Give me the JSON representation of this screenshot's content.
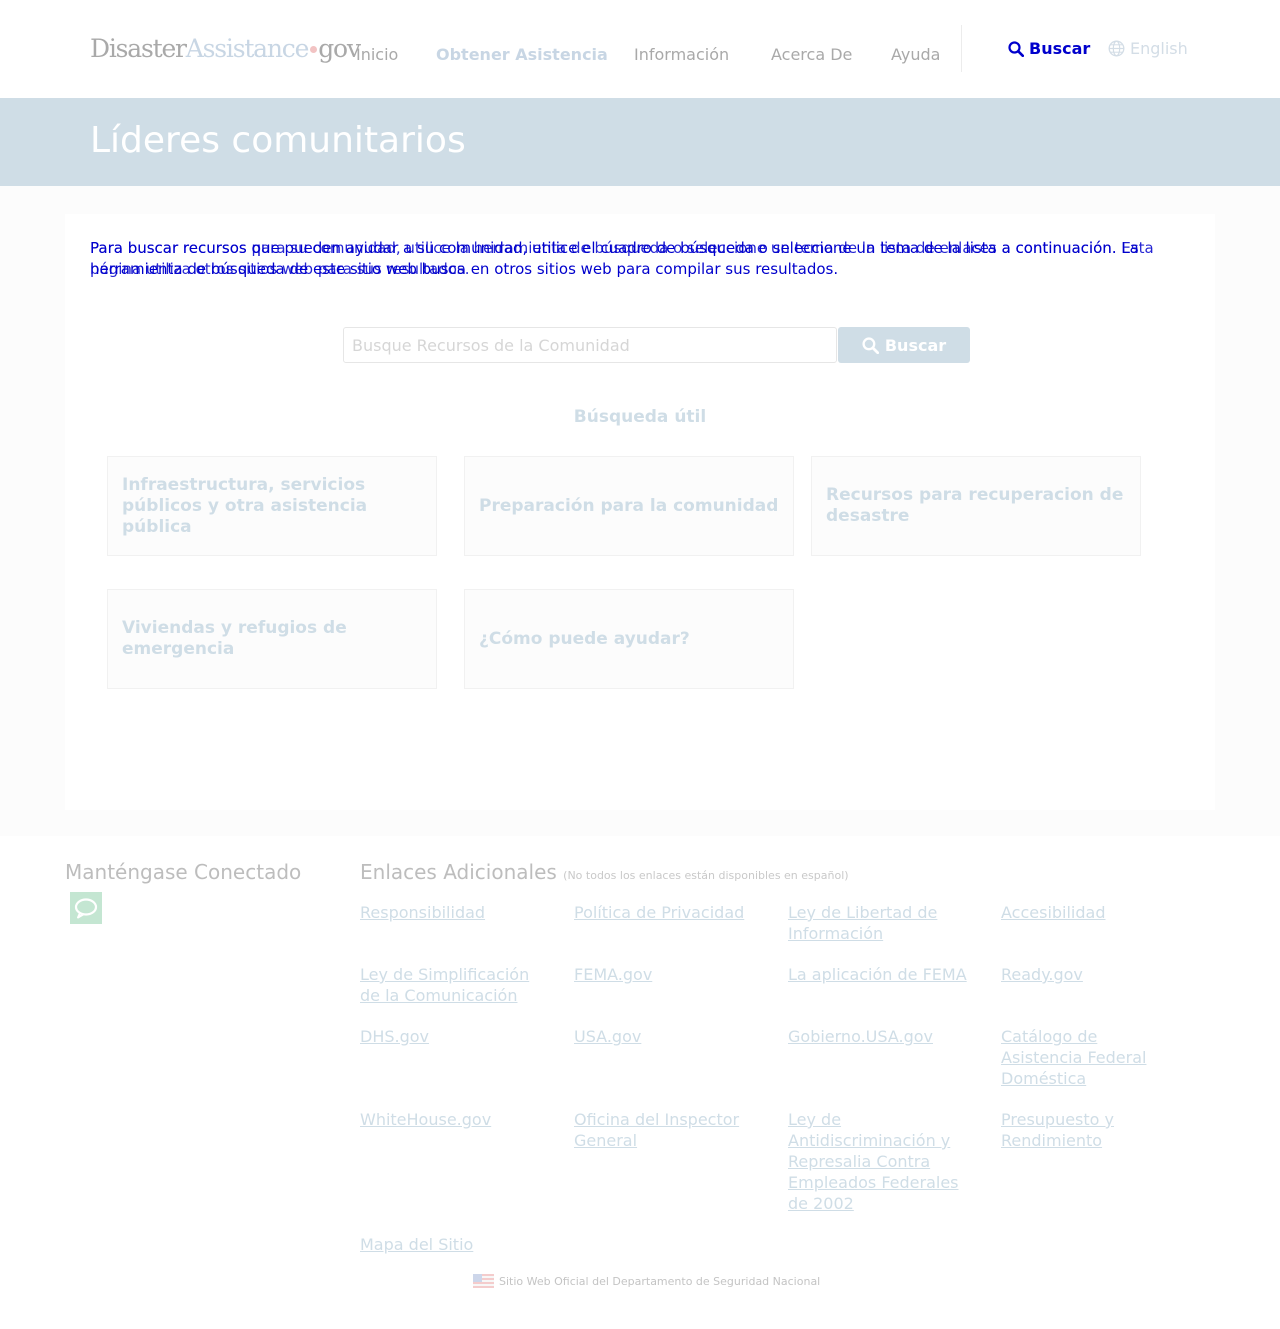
{
  "logo": {
    "part1": "Disaster",
    "part2": "Assistance",
    "part3": "gov"
  },
  "nav": {
    "items": [
      {
        "label": "Inicio"
      },
      {
        "label": "Obtener Asistencia"
      },
      {
        "label": "Información"
      },
      {
        "label": "Acerca De"
      },
      {
        "label": "Ayuda"
      }
    ],
    "search_label": "Buscar",
    "language_label": "English"
  },
  "banner": {
    "title": "Líderes comunitarios"
  },
  "intro": {
    "text": "Para buscar recursos que pueden ayudar a su comunidad, utilice el cuadro de búsqueda o seleccione un tema de la lista a continuación. La herramienta de búsqueda de este sitio web busca en otros sitios web para compilar sus resultados.",
    "overlap_text": "Para buscar recursos para su comunidad, utilice la herramienta de búsqueda o seleccione un tema de la lista de enlaces a continuación. Esta página utiliza otros sitios web para sus resultados."
  },
  "search": {
    "placeholder": "Busque Recursos de la Comunidad",
    "button_label": "Buscar"
  },
  "useful": {
    "title": "Búsqueda útil",
    "tiles": [
      {
        "label": "Infraestructura, servicios públicos y otra asistencia pública"
      },
      {
        "label": "Preparación para la comunidad"
      },
      {
        "label": "Recursos para recuperacion de desastre"
      },
      {
        "label": "Viviendas y refugios de emergencia"
      },
      {
        "label": "¿Cómo puede ayudar?"
      }
    ]
  },
  "footer": {
    "connected_title": "Manténgase Conectado",
    "links_title": "Enlaces Adicionales",
    "links_note": "(No todos los enlaces están disponibles en español)",
    "links": [
      {
        "label": "Responsibilidad"
      },
      {
        "label": "Política de Privacidad"
      },
      {
        "label": "Ley de Libertad de Información"
      },
      {
        "label": "Accesibilidad"
      },
      {
        "label": "Ley de Simplificación de la Comunicación"
      },
      {
        "label": "FEMA.gov"
      },
      {
        "label": "La aplicación de FEMA"
      },
      {
        "label": "Ready.gov"
      },
      {
        "label": "DHS.gov"
      },
      {
        "label": "USA.gov"
      },
      {
        "label": "Gobierno.USA.gov"
      },
      {
        "label": "Catálogo de Asistencia Federal Doméstica"
      },
      {
        "label": "WhiteHouse.gov"
      },
      {
        "label": "Oficina del Inspector General"
      },
      {
        "label": "Ley de Antidiscriminación y Represalia Contra Empleados Federales de 2002"
      },
      {
        "label": "Presupuesto y Rendimiento"
      },
      {
        "label": "Mapa del Sitio"
      }
    ],
    "official_text": "Sitio Web Oficial del Departamento de Seguridad Nacional"
  },
  "colors": {
    "accent": "#cfdde6",
    "link_blue": "#0000cc",
    "chat_green": "#c4e6d2"
  }
}
